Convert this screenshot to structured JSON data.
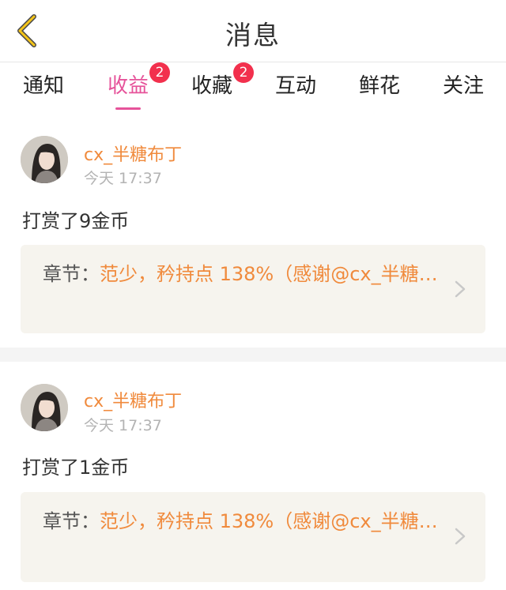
{
  "header": {
    "title": "消息"
  },
  "tabs": [
    {
      "label": "通知",
      "badge": ""
    },
    {
      "label": "收益",
      "badge": "2",
      "active": true
    },
    {
      "label": "收藏",
      "badge": "2"
    },
    {
      "label": "互动",
      "badge": ""
    },
    {
      "label": "鲜花",
      "badge": ""
    },
    {
      "label": "关注",
      "badge": ""
    }
  ],
  "messages": [
    {
      "username": "cx_半糖布丁",
      "time": "今天 17:37",
      "text": "打赏了9金币",
      "chapter_label": "章节：",
      "chapter_title": "范少，矜持点 138%（感谢@cx_半糖…"
    },
    {
      "username": "cx_半糖布丁",
      "time": "今天 17:37",
      "text": "打赏了1金币",
      "chapter_label": "章节：",
      "chapter_title": "范少，矜持点 138%（感谢@cx_半糖…"
    }
  ],
  "colors": {
    "accent": "#e6539a",
    "badge": "#f2304d",
    "username": "#f08a3c",
    "chapter_bg": "#f6f4ee"
  }
}
